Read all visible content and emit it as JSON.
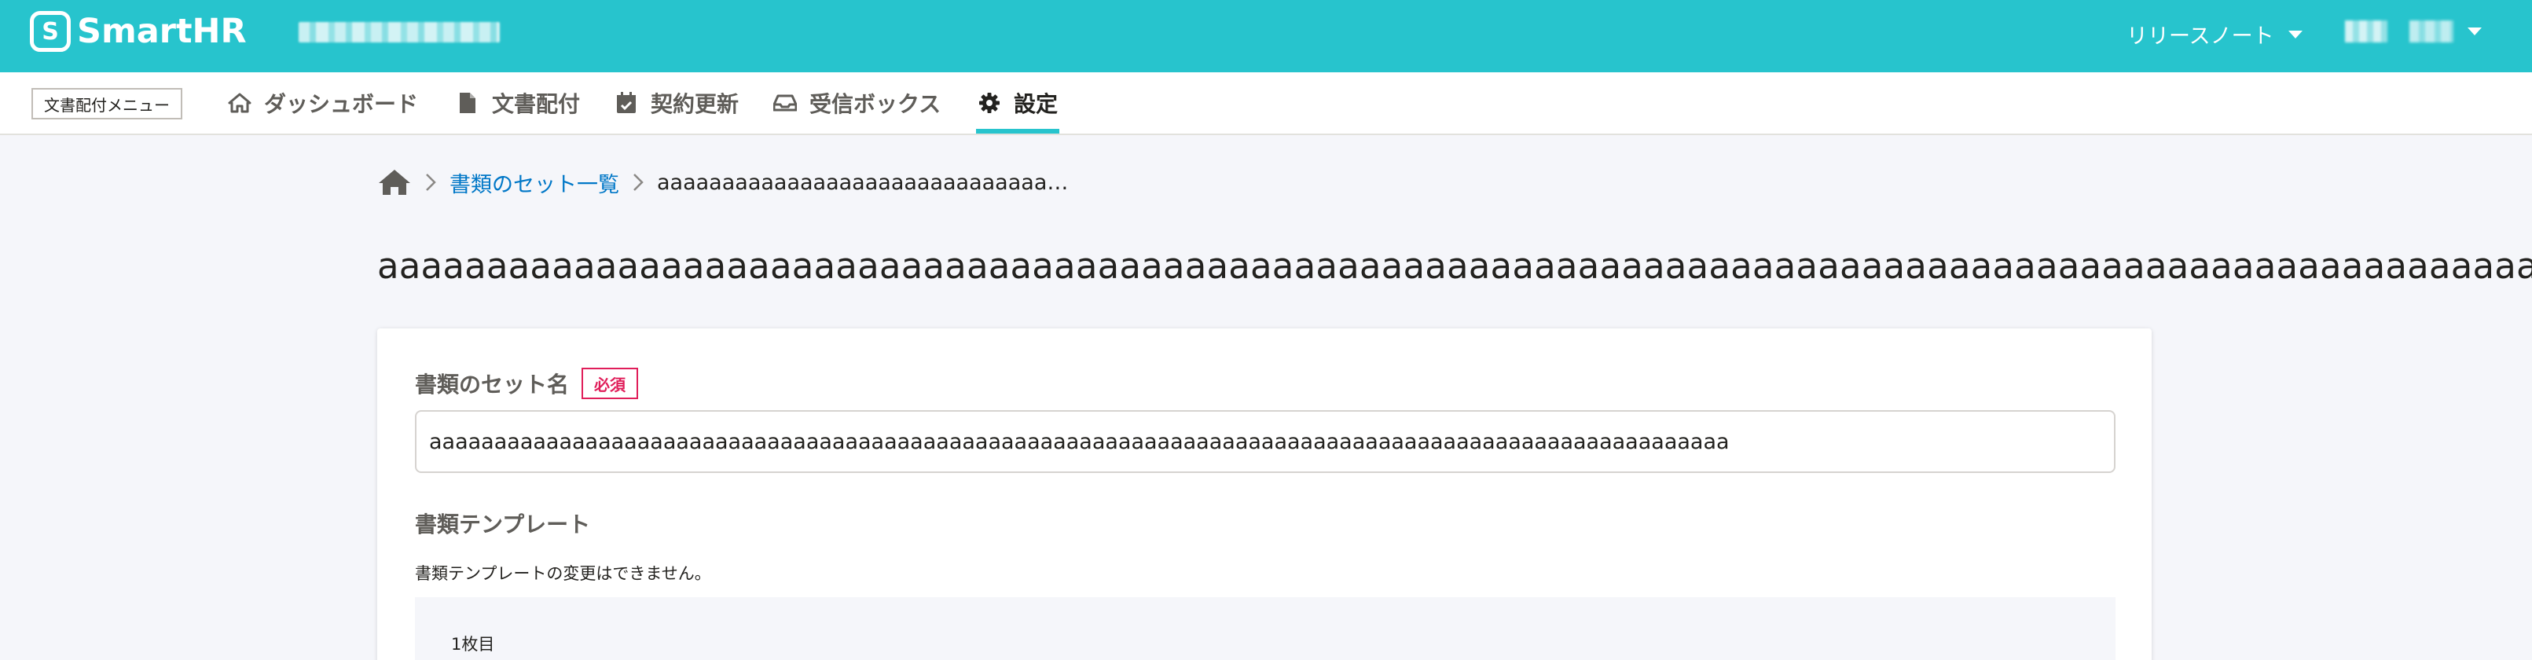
{
  "header": {
    "logo_mark": "S",
    "logo_text": "SmartHR",
    "release_note_label": "リリースノート"
  },
  "subnav": {
    "menu_badge": "文書配付メニュー",
    "items": [
      {
        "label": "ダッシュボード",
        "icon": "home-icon"
      },
      {
        "label": "文書配付",
        "icon": "file-icon"
      },
      {
        "label": "契約更新",
        "icon": "calendar-check-icon"
      },
      {
        "label": "受信ボックス",
        "icon": "inbox-icon"
      },
      {
        "label": "設定",
        "icon": "gear-icon",
        "active": true
      }
    ]
  },
  "breadcrumb": {
    "link": "書類のセット一覧",
    "current": "aaaaaaaaaaaaaaaaaaaaaaaaaaaaaa…"
  },
  "page": {
    "title": "aaaaaaaaaaaaaaaaaaaaaaaaaaaaaaaaaaaaaaaaaaaaaaaaaaaaaaaaaaaaaaaaaaaaaaaaaaaaaaaaaaaaaaaaaaaaaaaaaaaaaaaaaaaaaaa"
  },
  "form": {
    "set_name_label": "書類のセット名",
    "required_badge": "必須",
    "set_name_value": "aaaaaaaaaaaaaaaaaaaaaaaaaaaaaaaaaaaaaaaaaaaaaaaaaaaaaaaaaaaaaaaaaaaaaaaaaaaaaaaaaaaaaaaaaaaaaaaaaaaa",
    "template_label": "書類テンプレート",
    "template_note": "書類テンプレートの変更はできません。",
    "page_count": "1枚目"
  },
  "colors": {
    "brand": "#27c4cd",
    "link": "#0077c7",
    "required": "#e01e5a"
  }
}
